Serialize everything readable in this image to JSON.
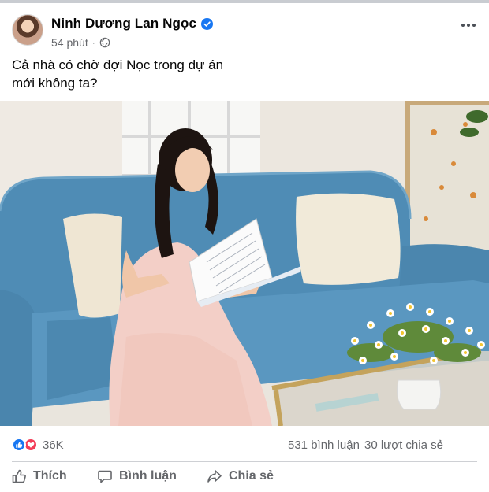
{
  "post": {
    "author": "Ninh Dương Lan Ngọc",
    "time": "54 phút",
    "separator": "·",
    "caption_line1": "Cả nhà có chờ đợi Nọc trong dự án",
    "caption_line2": "mới không ta?"
  },
  "stats": {
    "reaction_count": "36K",
    "comments": "531 bình luận",
    "shares": "30 lượt chia sẻ"
  },
  "actions": {
    "like": "Thích",
    "comment": "Bình luận",
    "share": "Chia sẻ"
  },
  "colors": {
    "brand_blue": "#1877f2",
    "love_red": "#f33e58",
    "secondary_text": "#65676b"
  },
  "icons": [
    "verified-badge-icon",
    "globe-icon",
    "more-options-icon",
    "like-reaction-icon",
    "love-reaction-icon",
    "thumbs-up-icon",
    "comment-bubble-icon",
    "share-arrow-icon"
  ]
}
